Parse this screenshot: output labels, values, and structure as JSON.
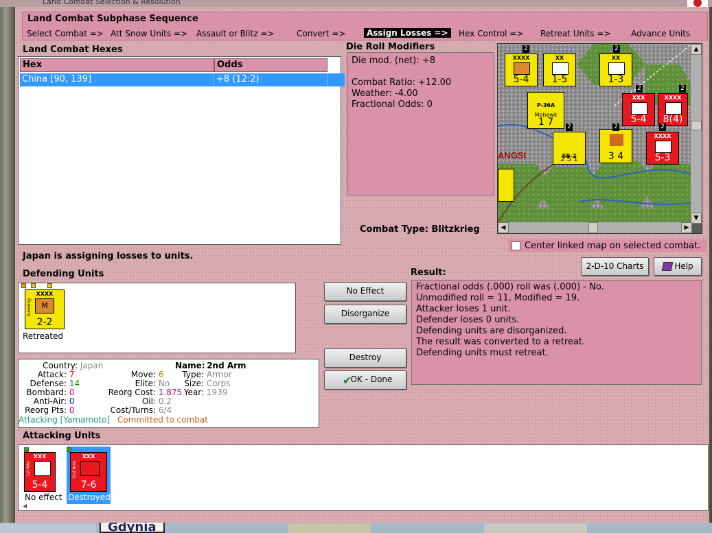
{
  "window": {
    "title": "Land Combat Selection & Resolution"
  },
  "sequence": {
    "title": "Land Combat Subphase Sequence",
    "steps": [
      {
        "label": "Select Combat =>"
      },
      {
        "label": "Att Snow Units =>"
      },
      {
        "label": "Assault or Blitz =>"
      },
      {
        "label": "Convert =>"
      },
      {
        "label": "Assign Losses =>",
        "active": true
      },
      {
        "label": "Hex Control =>"
      },
      {
        "label": "Retreat Units =>"
      },
      {
        "label": "Advance Units"
      }
    ]
  },
  "hexes": {
    "title": "Land Combat Hexes",
    "columns": [
      "Hex",
      "Odds"
    ],
    "rows": [
      {
        "hex": "China [90, 139]",
        "odds": "+8 (12:2)",
        "selected": true
      }
    ]
  },
  "die_roll": {
    "title": "Die Roll Modifiers",
    "lines": [
      "Die mod. (net): +8",
      "",
      "Combat Ratio: +12.00",
      "Weather: -4.00",
      "Fractional Odds: 0"
    ]
  },
  "combat_type": {
    "label": "Combat Type:",
    "value": "Blitzkrieg"
  },
  "map": {
    "region_label": "ANGSI",
    "counters": [
      {
        "top": "XXXX",
        "value": "5-4",
        "color": "#f5e600"
      },
      {
        "top": "XX",
        "value": "1-5",
        "color": "#f5e600"
      },
      {
        "top": "XX",
        "value": "1-3",
        "color": "#f5e600"
      },
      {
        "top": "XXX",
        "value": "5-4",
        "color": "#e8181e"
      },
      {
        "top": "XXXX",
        "value": "8(4)",
        "color": "#e8181e"
      },
      {
        "top": "P-36A",
        "value": "1 7",
        "color": "#f5e600"
      },
      {
        "top": "SB-2",
        "value": "2 5 1",
        "color": "#f5e600"
      },
      {
        "top": "",
        "value": "3 4",
        "color": "#f5e600"
      },
      {
        "top": "XXXX",
        "value": "5-3",
        "color": "#e8181e"
      }
    ],
    "counter_badges": [
      "2",
      "2",
      "2",
      "2",
      "2",
      "2",
      "2"
    ],
    "air_unit_name": "Mohawk"
  },
  "center_map_checkbox": {
    "label": "Center linked map on selected combat.",
    "checked": false
  },
  "buttons": {
    "charts": "2-D-10 Charts",
    "help": "Help",
    "no_effect": "No Effect",
    "disorganize": "Disorganize",
    "destroy": "Destroy",
    "ok_done": "OK - Done"
  },
  "status_message": "Japan is assigning losses to units.",
  "defending": {
    "title": "Defending Units",
    "units": [
      {
        "top": "XXXX",
        "side_label": "Kunming",
        "symbol": "M",
        "value": "2-2",
        "color": "#f5e600",
        "caption": "Retreated"
      }
    ]
  },
  "unit_detail": {
    "country_label": "Country:",
    "country": "Japan",
    "attack_label": "Attack:",
    "attack": "7",
    "defense_label": "Defense:",
    "defense": "14",
    "bombard_label": "Bombard:",
    "bombard": "0",
    "antiair_label": "Anti-Air:",
    "antiair": "0",
    "reorg_pts_label": "Reorg Pts:",
    "reorg_pts": "0",
    "move_label": "Move:",
    "move": "6",
    "elite_label": "Elite:",
    "elite": "No",
    "reorg_cost_label": "Reorg Cost:",
    "reorg_cost": "1.875",
    "oil_label": "Oil:",
    "oil": "0.2",
    "cost_turns_label": "Cost/Turns:",
    "cost_turns": "6/4",
    "name_label": "Name:",
    "name": "2nd Arm",
    "type_label": "Type:",
    "type": "Armor",
    "size_label": "Size:",
    "size": "Corps",
    "year_label": "Year:",
    "year": "1939",
    "attacking_status": "Attacking [Yamamoto]",
    "committed_status": "Committed to combat"
  },
  "result": {
    "title": "Result:",
    "lines": [
      "Fractional odds (.000) roll was (.000)  - No.",
      "Unmodified roll = 11, Modified = 19.",
      "Attacker loses 1 unit.",
      "Defender loses 0 units.",
      "Defending units are disorganized.",
      "The result was converted to a retreat.",
      "Defending units must retreat."
    ]
  },
  "attacking": {
    "title": "Attacking Units",
    "units": [
      {
        "top": "XXX",
        "side_label": "1st Mtn",
        "value": "5-4",
        "color": "#e8181e",
        "caption": "No effect",
        "selected": false
      },
      {
        "top": "XXX",
        "side_label": "2nd Arm",
        "value": "7-6",
        "color": "#e8181e",
        "caption": "Destroyed",
        "selected": true
      }
    ]
  },
  "background_map": {
    "city": "Gdynia"
  },
  "colors": {
    "panel": "#d8acb0",
    "accent_pink": "#d992a7",
    "selection": "#3399ff",
    "japan_red": "#e8181e",
    "china_yellow": "#f5e600"
  }
}
